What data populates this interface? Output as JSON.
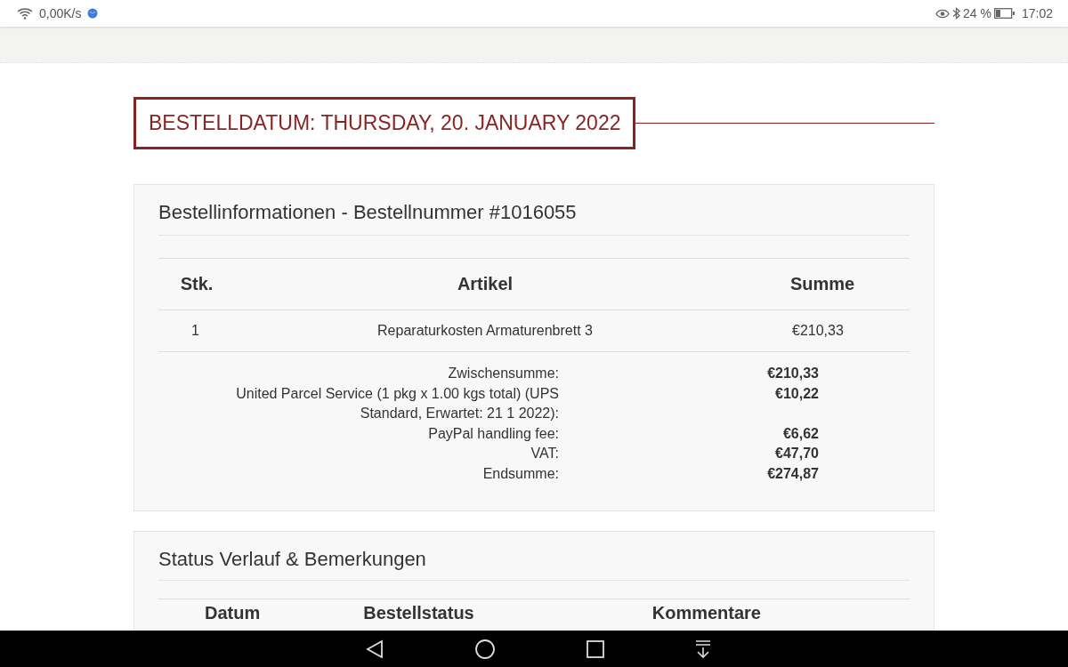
{
  "status_bar": {
    "network_speed": "0,00K/s",
    "battery_percent": "24 %",
    "time": "17:02"
  },
  "order_date_heading": "BESTELLDATUM: THURSDAY, 20. JANUARY 2022",
  "order_info": {
    "title": "Bestellinformationen - Bestellnummer #1016055",
    "columns": [
      "Stk.",
      "Artikel",
      "Summe"
    ],
    "rows": [
      {
        "qty": "1",
        "item": "Reparaturkosten Armaturenbrett 3",
        "sum": "€210,33"
      }
    ],
    "totals": [
      {
        "label": "Zwischensumme:",
        "value": "€210,33"
      },
      {
        "label": "United Parcel Service (1 pkg x 1.00 kgs total) (UPS Standard, Erwartet: 21 1 2022):",
        "value": "€10,22"
      },
      {
        "label": "PayPal handling fee:",
        "value": "€6,62"
      },
      {
        "label": "VAT:",
        "value": "€47,70"
      },
      {
        "label": "Endsumme:",
        "value": "€274,87"
      }
    ]
  },
  "status_history": {
    "title": "Status Verlauf & Bemerkungen",
    "columns": [
      "Datum",
      "Bestellstatus",
      "Kommentare"
    ]
  }
}
